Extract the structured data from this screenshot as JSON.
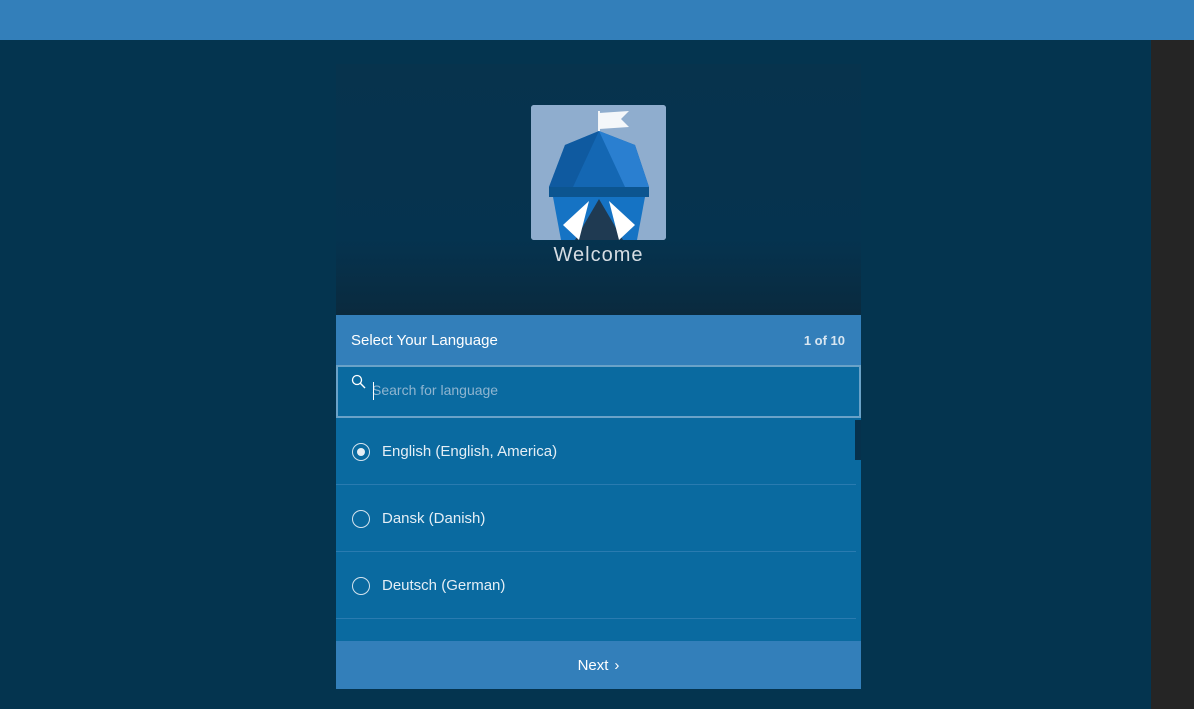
{
  "welcome": {
    "title": "Welcome"
  },
  "language": {
    "heading": "Select Your Language",
    "step": "1 of 10",
    "search_placeholder": "Search for language",
    "items": [
      {
        "label": "English (English, America)",
        "selected": true
      },
      {
        "label": "Dansk (Danish)",
        "selected": false
      },
      {
        "label": "Deutsch (German)",
        "selected": false
      }
    ]
  },
  "footer": {
    "next_label": "Next",
    "next_icon": "chevron-right-icon"
  },
  "colors": {
    "topbar": "#337fba",
    "background": "#04344f",
    "accent": "#337fba",
    "list_bg": "#0a6aa0"
  }
}
